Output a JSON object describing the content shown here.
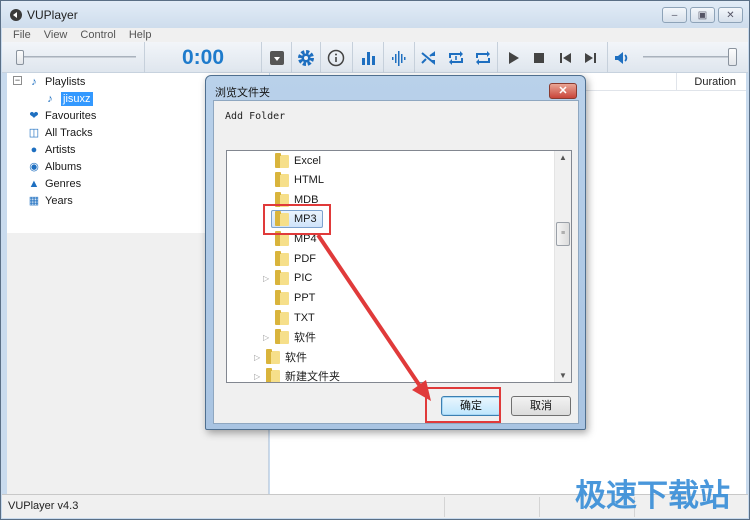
{
  "window": {
    "title": "VUPlayer",
    "controls": [
      "minimize",
      "maximize",
      "close"
    ]
  },
  "menu": [
    "File",
    "View",
    "Control",
    "Help"
  ],
  "toolbar": {
    "time": "0:00",
    "seek_position": 0,
    "volume": 1.0,
    "buttons": [
      "save-icon",
      "gear-icon",
      "info-icon",
      "equalizer-icon",
      "waveform-icon",
      "shuffle-icon",
      "repeat-one-icon",
      "repeat-icon",
      "play-icon",
      "stop-icon",
      "previous-icon",
      "next-icon",
      "volume-icon"
    ]
  },
  "sidebar": {
    "items": [
      {
        "label": "Playlists",
        "icon": "music-note-icon",
        "expanded": true
      },
      {
        "label": "jisuxz",
        "icon": "music-note-icon",
        "selected": true
      },
      {
        "label": "Favourites",
        "icon": "heart-icon"
      },
      {
        "label": "All Tracks",
        "icon": "tracks-icon"
      },
      {
        "label": "Artists",
        "icon": "person-icon"
      },
      {
        "label": "Albums",
        "icon": "disc-icon"
      },
      {
        "label": "Genres",
        "icon": "genres-icon"
      },
      {
        "label": "Years",
        "icon": "calendar-icon"
      }
    ]
  },
  "main": {
    "columns": [
      "Duration"
    ]
  },
  "status": {
    "text": "VUPlayer v4.3"
  },
  "watermark": "极速下载站",
  "dialog": {
    "title": "浏览文件夹",
    "description": "Add Folder",
    "folders": [
      {
        "name": "Excel",
        "expandable": false,
        "level": 2
      },
      {
        "name": "HTML",
        "expandable": false,
        "level": 2
      },
      {
        "name": "MDB",
        "expandable": false,
        "level": 2
      },
      {
        "name": "MP3",
        "expandable": false,
        "level": 2,
        "selected": true
      },
      {
        "name": "MP4",
        "expandable": false,
        "level": 2
      },
      {
        "name": "PDF",
        "expandable": false,
        "level": 2
      },
      {
        "name": "PIC",
        "expandable": true,
        "level": 2
      },
      {
        "name": "PPT",
        "expandable": false,
        "level": 2
      },
      {
        "name": "TXT",
        "expandable": false,
        "level": 2
      },
      {
        "name": "软件",
        "expandable": true,
        "level": 2
      },
      {
        "name": "软件",
        "expandable": true,
        "level": 1
      },
      {
        "name": "新建文件夹",
        "expandable": true,
        "level": 1
      }
    ],
    "ok_label": "确定",
    "cancel_label": "取消"
  },
  "colors": {
    "accent": "#1e7bcc",
    "selection": "#3399ff",
    "annotation": "#e03a3a"
  }
}
